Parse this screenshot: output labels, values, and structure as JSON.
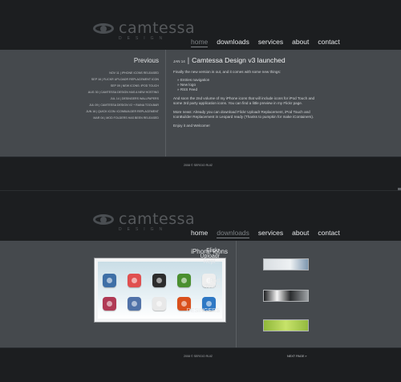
{
  "logo": {
    "name": "camtessa",
    "sub": "DESIGN"
  },
  "nav": [
    "home",
    "downloads",
    "services",
    "about",
    "contact"
  ],
  "page1": {
    "sidebar_title": "Previous",
    "recent": [
      "NOV 11 | IPHONE ICONS RELEASED",
      "SEP 16 | FLICKR UPLOADR REPLACEMENT ICON",
      "SEP 09 | NEW ICONS: IPOD TOUCH",
      "AUG 30 | CAMTESSA DESIGN HAS A NEW HOSTING",
      "JUL 14 | DESINGERS WALLPAPERS",
      "JUL 09 | CAMTESSA DESIGN V2 + RAINA TOOLBAR",
      "JUN 16 | QUICK ICON: ICONBUILDER REPLACEMENT",
      "MAR 04 | MOD FOLDERS HAS BEEN RELEASED"
    ],
    "post": {
      "date": "JAN 14",
      "sep": "|",
      "title": "Camtessa Design v3 launched",
      "intro": "Finally the new version is out, and it comes with some new things:",
      "features": [
        "Entries navigation",
        "New logo",
        "RSS Feed"
      ],
      "p2": "And soon the 2nd volume of my iPhone icons that will include icons for iPod Touch and some 3rd party application icons. You can find a little preview in my Flickr page.",
      "p3": "More news: Already you can download Flickr Uploadr Replacement, iPod Touch and IconBuilder Replacement in Leopard ready (Thanks to pumpkin for make iContainers).",
      "p4": "Enjoy it and Welcome!"
    },
    "copyright": "2008 © SERGIO RUIZ"
  },
  "page2": {
    "section_title": "iPhone icons",
    "sidebar": [
      {
        "title": "Flickr Uploadr Repl..."
      },
      {
        "title": "iPod Touch"
      },
      {
        "title": "DESINGERS"
      }
    ],
    "copyright": "2008 © SERGIO RUIZ",
    "next_page": "NEXT PAGE »"
  },
  "icons": [
    {
      "name": "weather-icon",
      "color": "#3e6fa6"
    },
    {
      "name": "calendar-icon",
      "color": "#e04f4f"
    },
    {
      "name": "speaker-icon",
      "color": "#2c2c2c"
    },
    {
      "name": "music-icon",
      "color": "#4a8f2f"
    },
    {
      "name": "notes-icon",
      "color": "#eeeeee"
    },
    {
      "name": "photos-icon",
      "color": "#b03a55"
    },
    {
      "name": "camera-icon",
      "color": "#5072a8"
    },
    {
      "name": "settings-icon",
      "color": "#e8e8e8"
    },
    {
      "name": "clock-icon",
      "color": "#d9501c"
    },
    {
      "name": "stocks-icon",
      "color": "#2e78c4"
    }
  ]
}
